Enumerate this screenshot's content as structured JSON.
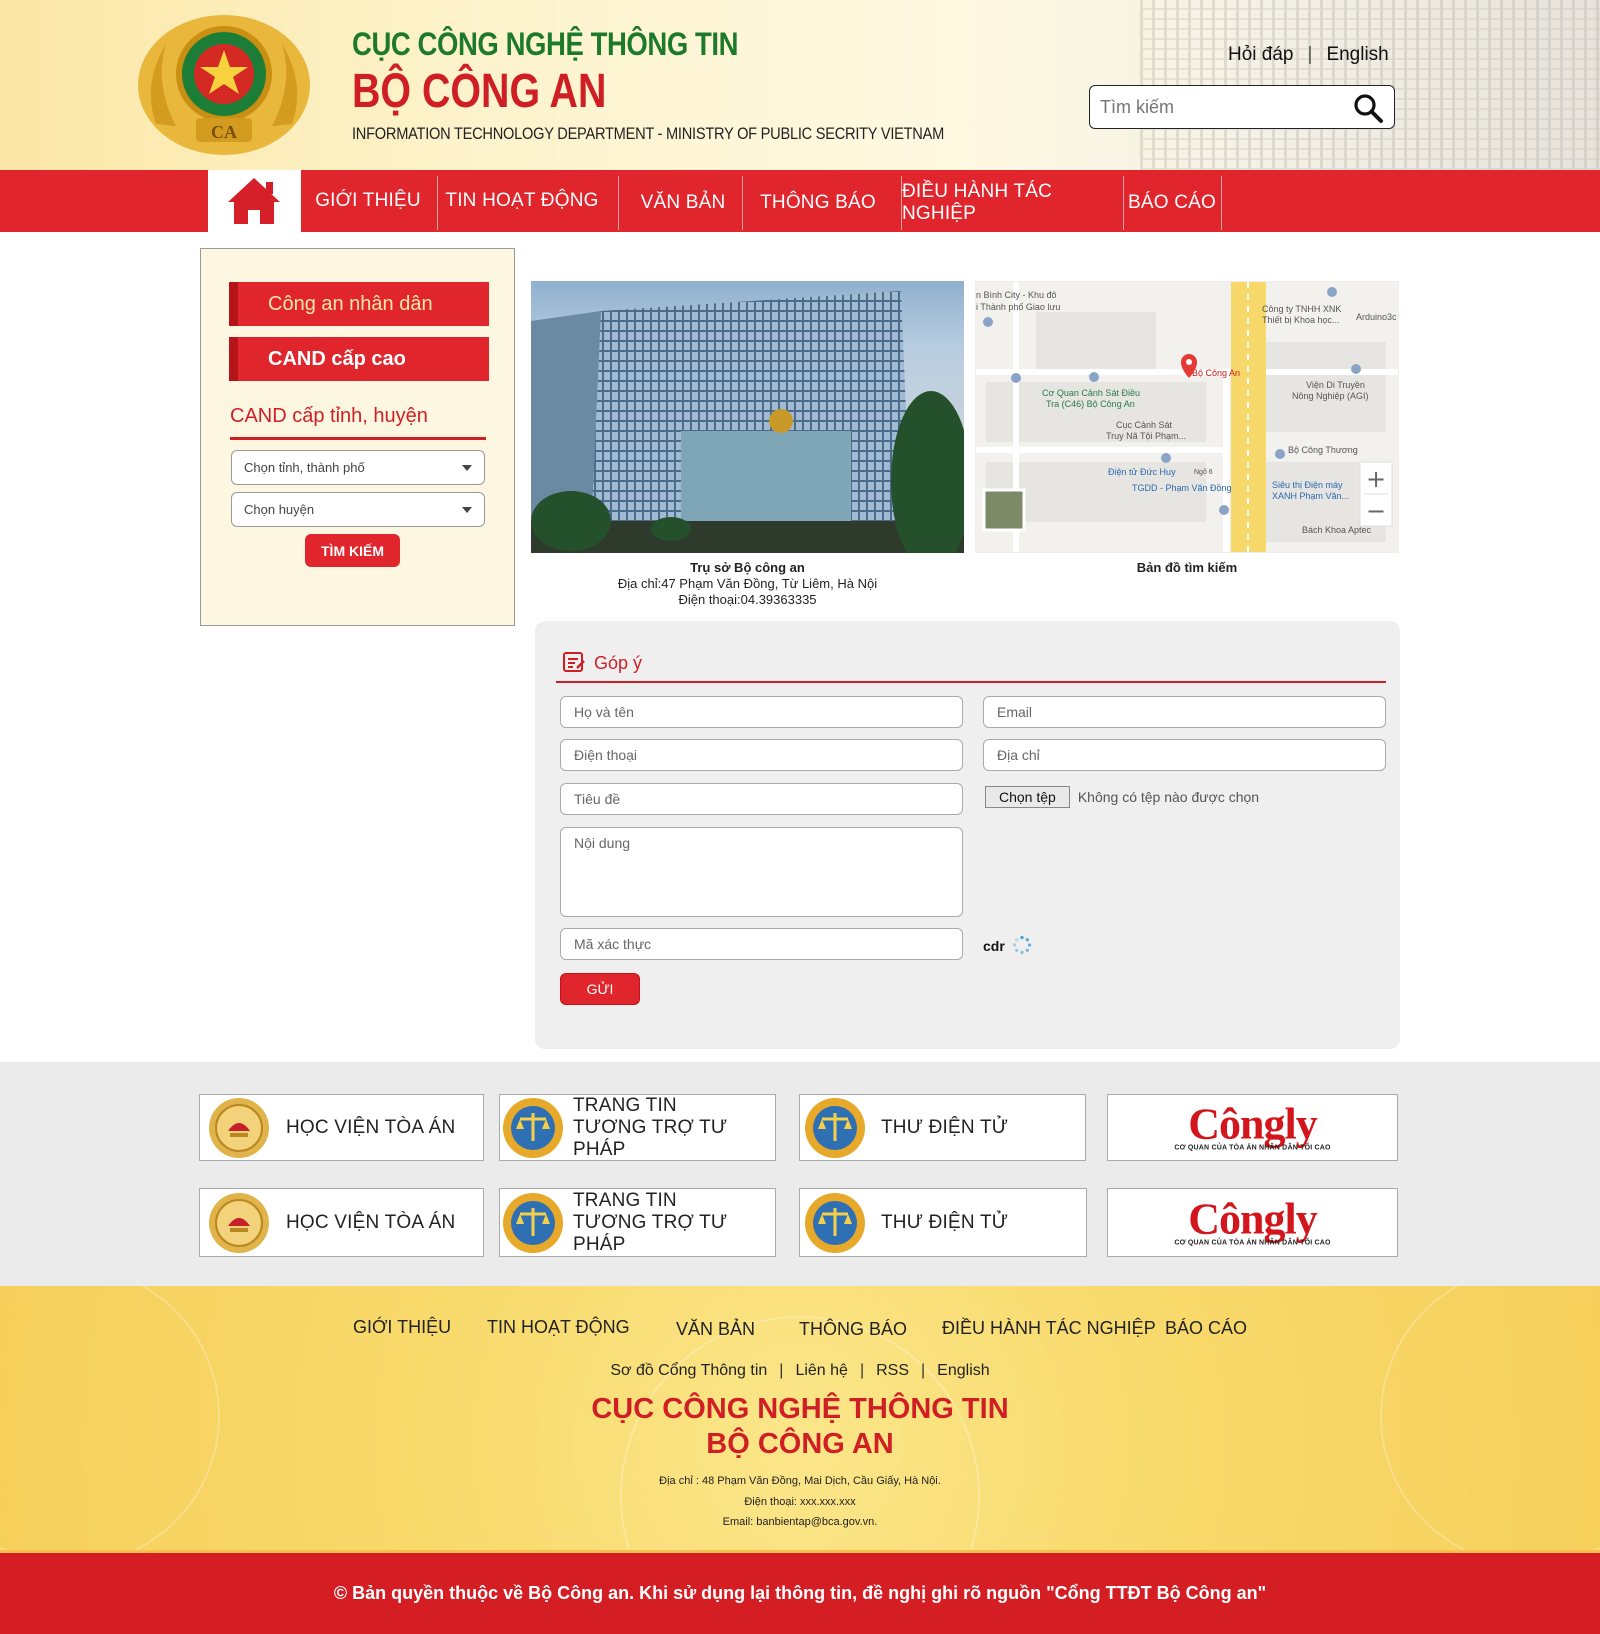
{
  "header": {
    "title_line1": "CỤC CÔNG NGHỆ THÔNG TIN",
    "title_line2": "BỘ CÔNG AN",
    "title_line3": "INFORMATION TECHNOLOGY DEPARTMENT - MINISTRY OF PUBLIC SECRITY VIETNAM",
    "link_faq": "Hỏi đáp",
    "link_english": "English",
    "search_placeholder": "Tìm kiếm"
  },
  "nav": {
    "items": [
      "GIỚI THIỆU",
      "TIN HOẠT ĐỘNG",
      "VĂN BẢN",
      "THÔNG BÁO",
      "ĐIỀU HÀNH TÁC NGHIỆP",
      "BÁO CÁO"
    ]
  },
  "sidebar": {
    "btn1": "Công an nhân dân",
    "btn2": "CAND cấp cao",
    "heading": "CAND cấp tỉnh, huyện",
    "select_province": "Chọn tỉnh, thành phố",
    "select_district": "Chọn huyện",
    "search_button": "TÌM KIẾM"
  },
  "media": {
    "photo_caption_title": "Trụ sở Bộ công an",
    "photo_caption_address": "Địa chỉ:47 Phạm Văn Đồng, Từ Liêm, Hà Nội",
    "photo_caption_phone": "Điện thoại:04.39363335",
    "map_caption": "Bản đồ tìm kiếm",
    "map_labels": [
      "n Bình City - Khu đô",
      "i Thành phố Giao lưu",
      "Công ty TNHH XNK",
      "Thiết bị Khoa học...",
      "Arduino3c",
      "Bộ Công An",
      "Viện Di Truyền",
      "Nông Nghiệp (AGI)",
      "Cơ Quan Cảnh Sát Điều",
      "Tra (C46) Bộ Công An",
      "Cục Cảnh Sát",
      "Truy Nã Tội Phạm...",
      "Bộ Công Thương",
      "Điện tử Đức Huy",
      "Ngõ 6",
      "TGDD - Phạm Văn Đồng",
      "Siêu thị Điện máy",
      "XANH Phạm Văn...",
      "Bách Khoa Aptec"
    ],
    "zoom_in": "+",
    "zoom_out": "−"
  },
  "feedback": {
    "title": "Góp ý",
    "name_placeholder": "Họ và tên",
    "email_placeholder": "Email",
    "phone_placeholder": "Điện thoại",
    "address_placeholder": "Địa chỉ",
    "subject_placeholder": "Tiêu đề",
    "file_button": "Chọn tệp",
    "file_status": "Không có tệp nào được chọn",
    "content_placeholder": "Nội dung",
    "captcha_placeholder": "Mã xác thực",
    "captcha_text": "cdr",
    "send_button": "GỬI"
  },
  "partners": {
    "hoc_vien": "HỌC VIỆN TÒA ÁN",
    "trang_tin_1": "TRANG TIN",
    "trang_tin_2": "TƯƠNG TRỢ TƯ PHÁP",
    "thu_dien_tu": "THƯ ĐIỆN TỬ",
    "cong_ly": "Côngly",
    "cong_ly_sub": "CƠ QUAN CỦA TÒA ÁN NHÂN DÂN TỐI CAO"
  },
  "footer": {
    "nav": [
      "GIỚI THIỆU",
      "TIN HOẠT ĐỘNG",
      "VĂN BẢN",
      "THÔNG BÁO",
      "ĐIỀU HÀNH TÁC NGHIỆP",
      "BÁO CÁO"
    ],
    "links": [
      "Sơ đồ Cổng Thông tin",
      "Liên hệ",
      "RSS",
      "English"
    ],
    "org_line1": "CỤC CÔNG NGHỆ THÔNG TIN",
    "org_line2": "BỘ CÔNG AN",
    "address": "Địa chỉ : 48 Phạm Văn Đồng, Mai Dịch, Cầu Giấy, Hà Nội.",
    "phone": "Điện thoại: xxx.xxx.xxx",
    "email": "Email: banbientap@bca.gov.vn.",
    "copyright": "© Bản quyền thuộc về Bộ Công an. Khi sử dụng lại thông tin, đề nghị ghi rõ nguồn \"Cổng TTĐT Bộ Công an\""
  },
  "colors": {
    "brand_red": "#e0262c",
    "title_green": "#1d7a2b",
    "title_red": "#cf1f25",
    "footer_gold": "#f8da6c"
  },
  "icons": [
    "emblem-icon",
    "search-icon",
    "home-icon",
    "feedback-icon",
    "loading-spinner-icon",
    "map-pin-icon",
    "court-academy-logo-icon",
    "scales-emblem-icon"
  ]
}
